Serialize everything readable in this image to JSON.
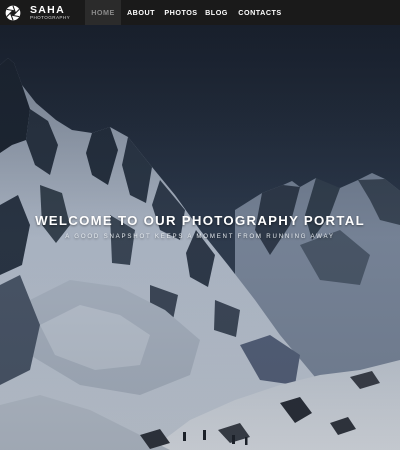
{
  "brand": {
    "name": "SAHA",
    "tagline": "PHOTOGRAPHY",
    "logo_icon": "aperture-icon"
  },
  "nav": {
    "active": "HOME",
    "items": [
      {
        "label": "HOME"
      },
      {
        "label": "ABOUT"
      },
      {
        "label": "PHOTOS"
      },
      {
        "label": "BLOG"
      },
      {
        "label": "CONTACTS"
      }
    ]
  },
  "hero": {
    "title": "WELCOME TO OUR PHOTOGRAPHY PORTAL",
    "subtitle": "A GOOD SNAPSHOT KEEPS A MOMENT FROM RUNNING AWAY"
  },
  "colors": {
    "navbar_bg": "#1a1a1a",
    "active_item_bg": "#2b2b2b",
    "active_item_text": "#8a8a8a",
    "nav_text": "#ffffff",
    "sky": "#1c2533"
  }
}
